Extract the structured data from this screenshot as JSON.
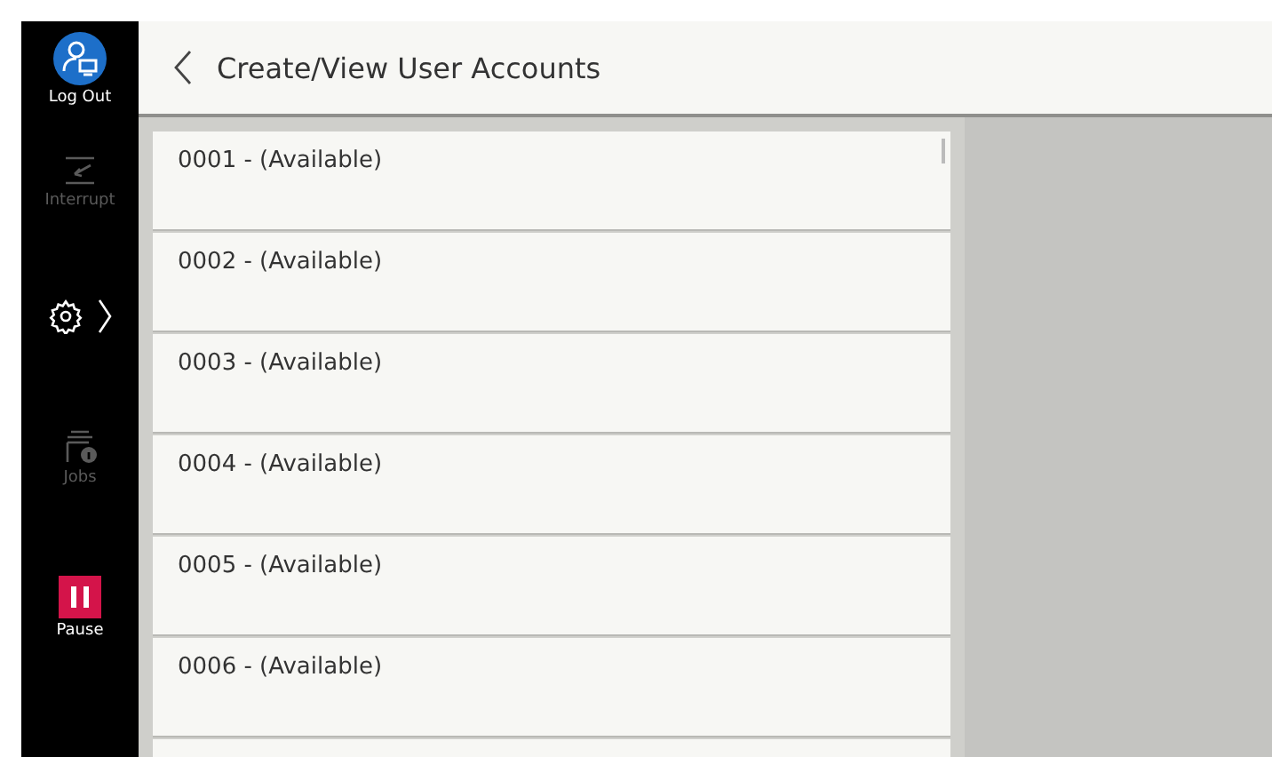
{
  "sidebar": {
    "items": [
      {
        "kind": "logout",
        "label": "Log Out",
        "disabled": false
      },
      {
        "kind": "interrupt",
        "label": "Interrupt",
        "disabled": true
      },
      {
        "kind": "settings",
        "disabled": false
      },
      {
        "kind": "jobs",
        "label": "Jobs",
        "disabled": true
      },
      {
        "kind": "pause",
        "label": "Pause",
        "disabled": false
      }
    ]
  },
  "header": {
    "title": "Create/View User Accounts"
  },
  "accounts": [
    {
      "label": "0001 - (Available)"
    },
    {
      "label": "0002 - (Available)"
    },
    {
      "label": "0003 - (Available)"
    },
    {
      "label": "0004 - (Available)"
    },
    {
      "label": "0005 - (Available)"
    },
    {
      "label": "0006 - (Available)"
    }
  ]
}
